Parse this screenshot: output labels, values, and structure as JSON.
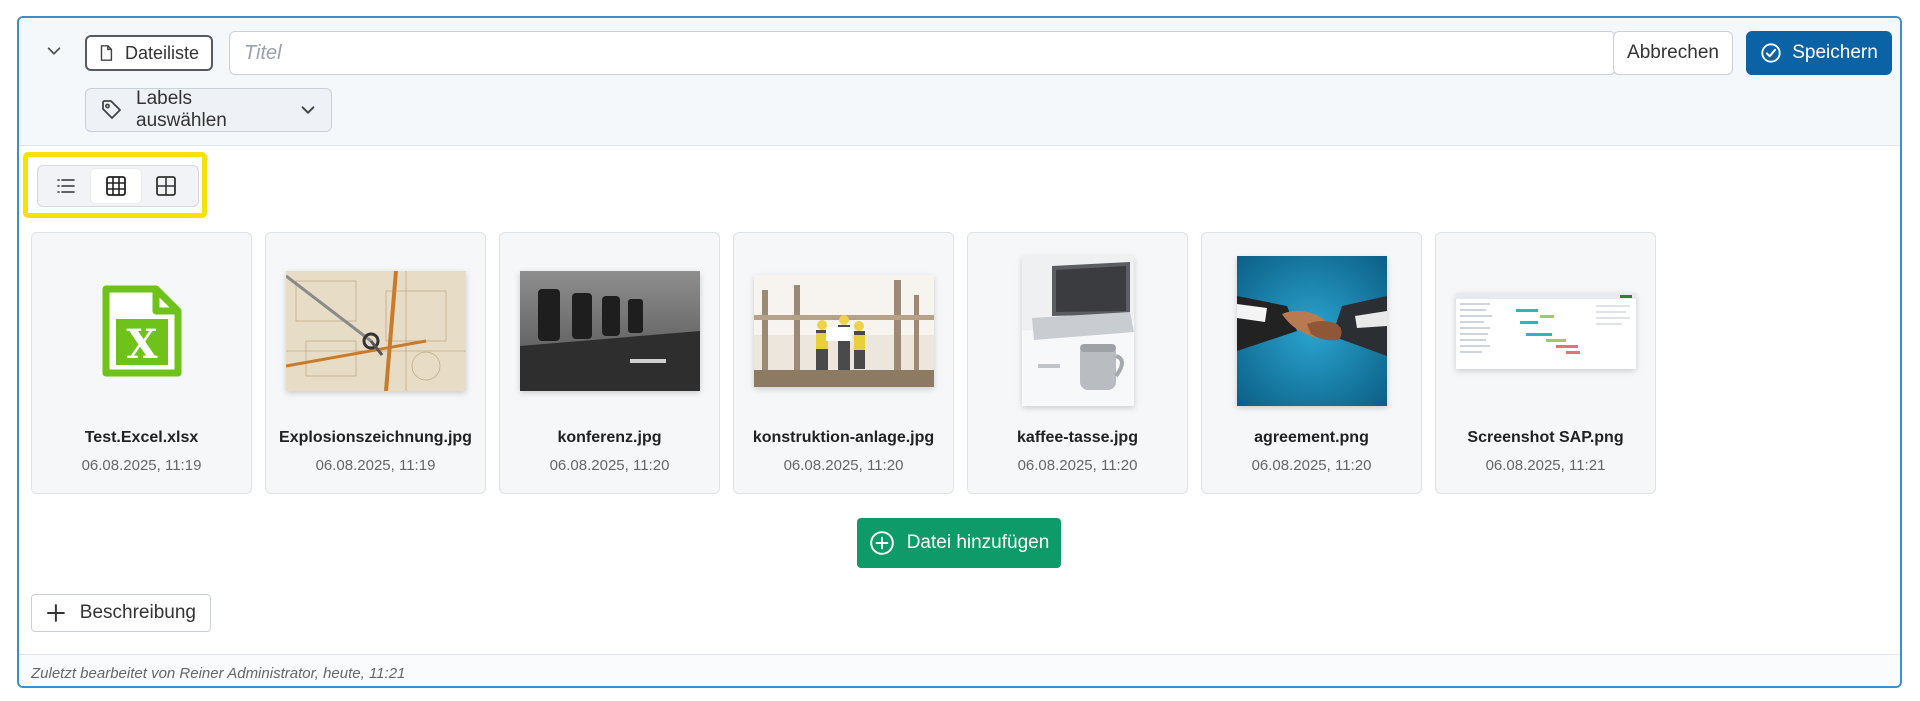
{
  "header": {
    "type_badge": "Dateiliste",
    "title_placeholder": "Titel",
    "title_value": "",
    "cancel_label": "Abbrechen",
    "save_label": "Speichern",
    "labels_label": "Labels auswählen"
  },
  "view_toggle": {
    "options": [
      "list-view",
      "table-view",
      "grid-view"
    ],
    "active": "table-view"
  },
  "files": [
    {
      "name": "Test.Excel.xlsx",
      "date": "06.08.2025, 11:19"
    },
    {
      "name": "Explosionszeichnung.jpg",
      "date": "06.08.2025, 11:19"
    },
    {
      "name": "konferenz.jpg",
      "date": "06.08.2025, 11:20"
    },
    {
      "name": "konstruktion-anlage.jpg",
      "date": "06.08.2025, 11:20"
    },
    {
      "name": "kaffee-tasse.jpg",
      "date": "06.08.2025, 11:20"
    },
    {
      "name": "agreement.png",
      "date": "06.08.2025, 11:20"
    },
    {
      "name": "Screenshot SAP.png",
      "date": "06.08.2025, 11:21"
    }
  ],
  "actions": {
    "add_file_label": "Datei hinzufügen",
    "add_description_label": "Beschreibung"
  },
  "footer": {
    "last_edited": "Zuletzt bearbeitet von Reiner Administrator, heute, 11:21"
  },
  "colors": {
    "accent": "#0b63a5",
    "success": "#0f9a6a",
    "highlight": "#f4e20a",
    "excel": "#6ec21a"
  }
}
